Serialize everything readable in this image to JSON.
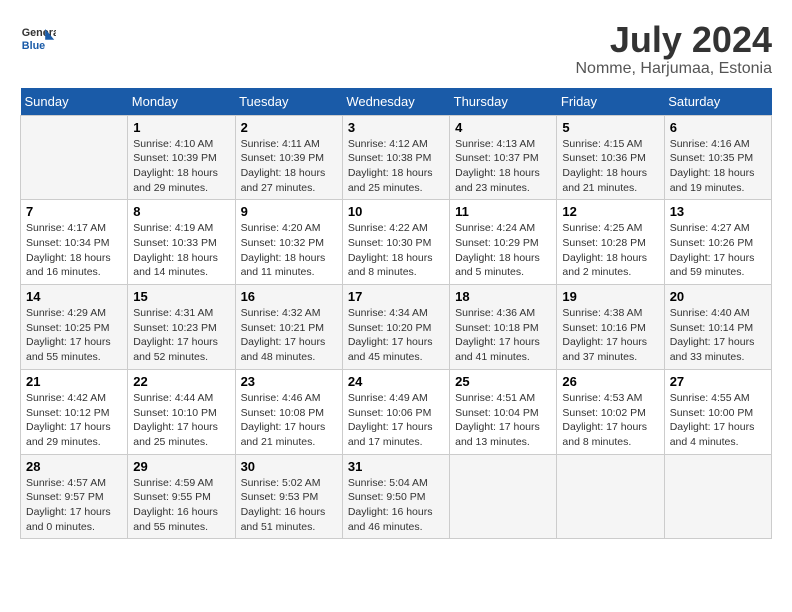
{
  "header": {
    "logo_line1": "General",
    "logo_line2": "Blue",
    "month": "July 2024",
    "location": "Nomme, Harjumaa, Estonia"
  },
  "days_of_week": [
    "Sunday",
    "Monday",
    "Tuesday",
    "Wednesday",
    "Thursday",
    "Friday",
    "Saturday"
  ],
  "weeks": [
    [
      {
        "day": "",
        "info": ""
      },
      {
        "day": "1",
        "info": "Sunrise: 4:10 AM\nSunset: 10:39 PM\nDaylight: 18 hours\nand 29 minutes."
      },
      {
        "day": "2",
        "info": "Sunrise: 4:11 AM\nSunset: 10:39 PM\nDaylight: 18 hours\nand 27 minutes."
      },
      {
        "day": "3",
        "info": "Sunrise: 4:12 AM\nSunset: 10:38 PM\nDaylight: 18 hours\nand 25 minutes."
      },
      {
        "day": "4",
        "info": "Sunrise: 4:13 AM\nSunset: 10:37 PM\nDaylight: 18 hours\nand 23 minutes."
      },
      {
        "day": "5",
        "info": "Sunrise: 4:15 AM\nSunset: 10:36 PM\nDaylight: 18 hours\nand 21 minutes."
      },
      {
        "day": "6",
        "info": "Sunrise: 4:16 AM\nSunset: 10:35 PM\nDaylight: 18 hours\nand 19 minutes."
      }
    ],
    [
      {
        "day": "7",
        "info": "Sunrise: 4:17 AM\nSunset: 10:34 PM\nDaylight: 18 hours\nand 16 minutes."
      },
      {
        "day": "8",
        "info": "Sunrise: 4:19 AM\nSunset: 10:33 PM\nDaylight: 18 hours\nand 14 minutes."
      },
      {
        "day": "9",
        "info": "Sunrise: 4:20 AM\nSunset: 10:32 PM\nDaylight: 18 hours\nand 11 minutes."
      },
      {
        "day": "10",
        "info": "Sunrise: 4:22 AM\nSunset: 10:30 PM\nDaylight: 18 hours\nand 8 minutes."
      },
      {
        "day": "11",
        "info": "Sunrise: 4:24 AM\nSunset: 10:29 PM\nDaylight: 18 hours\nand 5 minutes."
      },
      {
        "day": "12",
        "info": "Sunrise: 4:25 AM\nSunset: 10:28 PM\nDaylight: 18 hours\nand 2 minutes."
      },
      {
        "day": "13",
        "info": "Sunrise: 4:27 AM\nSunset: 10:26 PM\nDaylight: 17 hours\nand 59 minutes."
      }
    ],
    [
      {
        "day": "14",
        "info": "Sunrise: 4:29 AM\nSunset: 10:25 PM\nDaylight: 17 hours\nand 55 minutes."
      },
      {
        "day": "15",
        "info": "Sunrise: 4:31 AM\nSunset: 10:23 PM\nDaylight: 17 hours\nand 52 minutes."
      },
      {
        "day": "16",
        "info": "Sunrise: 4:32 AM\nSunset: 10:21 PM\nDaylight: 17 hours\nand 48 minutes."
      },
      {
        "day": "17",
        "info": "Sunrise: 4:34 AM\nSunset: 10:20 PM\nDaylight: 17 hours\nand 45 minutes."
      },
      {
        "day": "18",
        "info": "Sunrise: 4:36 AM\nSunset: 10:18 PM\nDaylight: 17 hours\nand 41 minutes."
      },
      {
        "day": "19",
        "info": "Sunrise: 4:38 AM\nSunset: 10:16 PM\nDaylight: 17 hours\nand 37 minutes."
      },
      {
        "day": "20",
        "info": "Sunrise: 4:40 AM\nSunset: 10:14 PM\nDaylight: 17 hours\nand 33 minutes."
      }
    ],
    [
      {
        "day": "21",
        "info": "Sunrise: 4:42 AM\nSunset: 10:12 PM\nDaylight: 17 hours\nand 29 minutes."
      },
      {
        "day": "22",
        "info": "Sunrise: 4:44 AM\nSunset: 10:10 PM\nDaylight: 17 hours\nand 25 minutes."
      },
      {
        "day": "23",
        "info": "Sunrise: 4:46 AM\nSunset: 10:08 PM\nDaylight: 17 hours\nand 21 minutes."
      },
      {
        "day": "24",
        "info": "Sunrise: 4:49 AM\nSunset: 10:06 PM\nDaylight: 17 hours\nand 17 minutes."
      },
      {
        "day": "25",
        "info": "Sunrise: 4:51 AM\nSunset: 10:04 PM\nDaylight: 17 hours\nand 13 minutes."
      },
      {
        "day": "26",
        "info": "Sunrise: 4:53 AM\nSunset: 10:02 PM\nDaylight: 17 hours\nand 8 minutes."
      },
      {
        "day": "27",
        "info": "Sunrise: 4:55 AM\nSunset: 10:00 PM\nDaylight: 17 hours\nand 4 minutes."
      }
    ],
    [
      {
        "day": "28",
        "info": "Sunrise: 4:57 AM\nSunset: 9:57 PM\nDaylight: 17 hours\nand 0 minutes."
      },
      {
        "day": "29",
        "info": "Sunrise: 4:59 AM\nSunset: 9:55 PM\nDaylight: 16 hours\nand 55 minutes."
      },
      {
        "day": "30",
        "info": "Sunrise: 5:02 AM\nSunset: 9:53 PM\nDaylight: 16 hours\nand 51 minutes."
      },
      {
        "day": "31",
        "info": "Sunrise: 5:04 AM\nSunset: 9:50 PM\nDaylight: 16 hours\nand 46 minutes."
      },
      {
        "day": "",
        "info": ""
      },
      {
        "day": "",
        "info": ""
      },
      {
        "day": "",
        "info": ""
      }
    ]
  ]
}
